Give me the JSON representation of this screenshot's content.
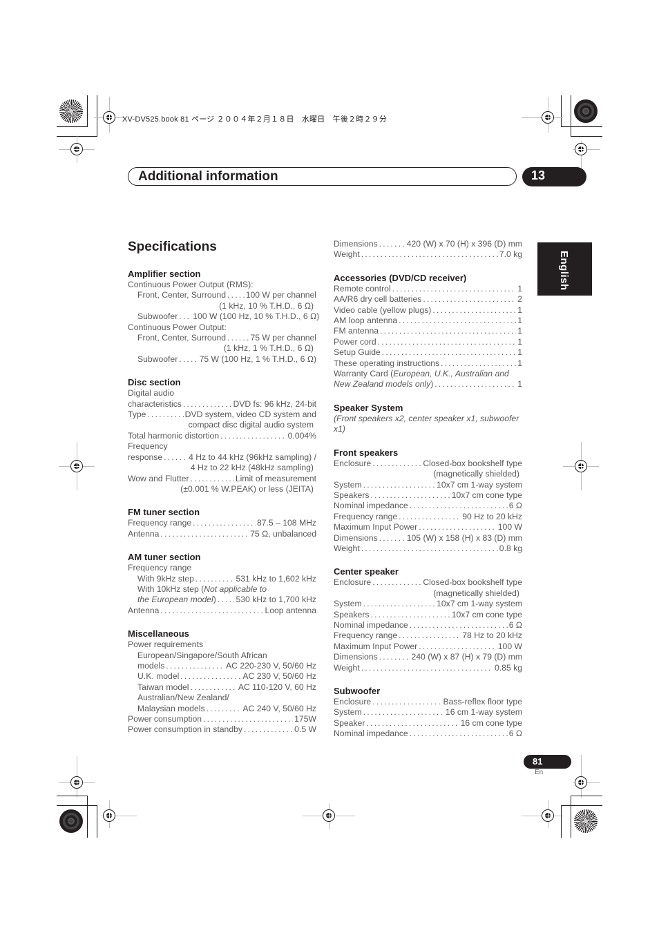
{
  "slug": "XV-DV525.book  81 ページ  ２００４年２月１８日　水曜日　午後２時２９分",
  "header": {
    "chapter_title": "Additional information",
    "chapter_number": "13",
    "language_tab": "English"
  },
  "page_title": "Specifications",
  "left_column": {
    "amplifier": {
      "title": "Amplifier section",
      "rms_label": "Continuous Power Output (RMS):",
      "rms_front_label": "Front, Center, Surround",
      "rms_front_value": "100 W per channel",
      "rms_front_cont": "(1 kHz, 10 % T.H.D., 6 Ω)",
      "rms_sub_label": "Subwoofer",
      "rms_sub_value": "100 W (100 Hz, 10 % T.H.D., 6 Ω)",
      "cpo_label": "Continuous Power Output:",
      "cpo_front_label": "Front, Center, Surround",
      "cpo_front_value": "75 W per channel",
      "cpo_front_cont": "(1 kHz, 1 % T.H.D., 6 Ω)",
      "cpo_sub_label": "Subwoofer",
      "cpo_sub_value": "75 W (100 Hz, 1 % T.H.D., 6 Ω)"
    },
    "disc": {
      "title": "Disc section",
      "dac_label_1": "Digital audio",
      "dac_label_2": "characteristics",
      "dac_value": "DVD fs: 96 kHz, 24-bit",
      "type_label": "Type",
      "type_value": "DVD system, video CD system and",
      "type_cont": "compact disc digital audio system",
      "thd_label": "Total harmonic distortion",
      "thd_value": "0.004%",
      "freq_label_1": "Frequency",
      "freq_label_2": "response",
      "freq_value": "4 Hz to 44 kHz (96kHz sampling) /",
      "freq_cont": "4 Hz to 22 kHz (48kHz sampling)",
      "wow_label": "Wow and Flutter",
      "wow_value": "Limit of measurement",
      "wow_cont": "(±0.001 % W.PEAK) or less (JEITA)"
    },
    "fm": {
      "title": "FM tuner section",
      "freq_label": "Frequency range",
      "freq_value": "87.5 – 108 MHz",
      "ant_label": "Antenna",
      "ant_value": "75 Ω, unbalanced"
    },
    "am": {
      "title": "AM tuner section",
      "freq_label": "Frequency range",
      "step9_label": "With 9kHz step",
      "step9_value": "531 kHz to 1,602 kHz",
      "step10_label": "With 10kHz step (",
      "step10_note_1": "Not applicable to",
      "step10_note_2": "the European model",
      "step10_close": ")",
      "step10_value": "530 kHz to 1,700 kHz",
      "ant_label": "Antenna",
      "ant_value": "Loop antenna"
    },
    "misc": {
      "title": "Miscellaneous",
      "power_req_label": "Power requirements",
      "eu_label_1": "European/Singapore/South African",
      "eu_label_2": "models",
      "eu_value": "AC 220-230 V, 50/60 Hz",
      "uk_label": "U.K. model",
      "uk_value": "AC 230 V, 50/60 Hz",
      "tw_label": "Taiwan model",
      "tw_value": "AC 110-120 V, 60 Hz",
      "au_label_1": "Australian/New Zealand/",
      "au_label_2": "Malaysian models",
      "au_value": "AC 240 V, 50/60 Hz",
      "consumption_label": "Power consumption",
      "consumption_value": "175W",
      "standby_label": "Power consumption in standby",
      "standby_value": "0.5 W"
    }
  },
  "right_column": {
    "main_unit": {
      "dim_label": "Dimensions",
      "dim_value": "420 (W) x 70 (H) x 396 (D) mm",
      "weight_label": "Weight",
      "weight_value": "7.0 kg"
    },
    "accessories": {
      "title": "Accessories (DVD/CD receiver)",
      "items": [
        {
          "label": "Remote control",
          "qty": "1"
        },
        {
          "label": "AA/R6 dry cell batteries",
          "qty": "2"
        },
        {
          "label": "Video cable (yellow plugs)",
          "qty": "1"
        },
        {
          "label": "AM loop antenna",
          "qty": "1"
        },
        {
          "label": "FM antenna",
          "qty": "1"
        },
        {
          "label": "Power cord",
          "qty": "1"
        },
        {
          "label": "Setup Guide",
          "qty": "1"
        },
        {
          "label": "These operating instructions",
          "qty": "1"
        }
      ],
      "warranty_label": "Warranty Card (",
      "warranty_note_1": "European, U.K., Australian and",
      "warranty_note_2": "New Zealand models only",
      "warranty_close": ")",
      "warranty_qty": "1"
    },
    "speaker_system": {
      "title": "Speaker System",
      "note": "(Front speakers x2, center speaker x1, subwoofer x1)"
    },
    "front": {
      "title": "Front speakers",
      "enclosure_label": "Enclosure",
      "enclosure_value": "Closed-box bookshelf type",
      "enclosure_cont": "(magnetically shielded)",
      "system_label": "System",
      "system_value": "10x7 cm 1-way system",
      "speakers_label": "Speakers",
      "speakers_value": "10x7 cm cone type",
      "impedance_label": "Nominal impedance",
      "impedance_value": "6 Ω",
      "freq_label": "Frequency range",
      "freq_value": "90 Hz to 20 kHz",
      "power_label": "Maximum Input Power",
      "power_value": "100 W",
      "dim_label": "Dimensions",
      "dim_value": "105 (W) x 158 (H) x 83 (D) mm",
      "weight_label": "Weight",
      "weight_value": "0.8 kg"
    },
    "center": {
      "title": "Center speaker",
      "enclosure_label": "Enclosure",
      "enclosure_value": "Closed-box bookshelf type",
      "enclosure_cont": "(magnetically shielded)",
      "system_label": "System",
      "system_value": "10x7 cm 1-way system",
      "speakers_label": "Speakers",
      "speakers_value": "10x7 cm cone type",
      "impedance_label": "Nominal impedance",
      "impedance_value": "6 Ω",
      "freq_label": "Frequency range",
      "freq_value": "78 Hz to 20 kHz",
      "power_label": "Maximum Input Power",
      "power_value": "100 W",
      "dim_label": "Dimensions",
      "dim_value": "240 (W) x 87 (H) x 79 (D) mm",
      "weight_label": "Weight",
      "weight_value": "0.85 kg"
    },
    "subwoofer": {
      "title": "Subwoofer",
      "enclosure_label": "Enclosure",
      "enclosure_value": "Bass-reflex floor type",
      "system_label": "System",
      "system_value": "16 cm 1-way system",
      "speaker_label": "Speaker",
      "speaker_value": "16 cm cone type",
      "impedance_label": "Nominal impedance",
      "impedance_value": "6 Ω"
    }
  },
  "footer": {
    "page_number": "81",
    "page_lang": "En"
  }
}
